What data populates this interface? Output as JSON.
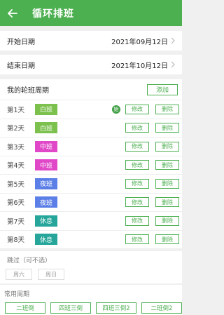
{
  "header": {
    "title": "循环排班"
  },
  "start": {
    "label": "开始日期",
    "value": "2021年09月12日"
  },
  "end": {
    "label": "结束日期",
    "value": "2021年10月12日"
  },
  "cycle": {
    "title": "我的轮班周期",
    "add_label": "添加",
    "start_badge": "始",
    "edit_label": "修改",
    "delete_label": "删除",
    "days": [
      {
        "day": "第1天",
        "shift": "白班",
        "color": "#7cc04e"
      },
      {
        "day": "第2天",
        "shift": "白班",
        "color": "#7cc04e"
      },
      {
        "day": "第3天",
        "shift": "中班",
        "color": "#e048c8"
      },
      {
        "day": "第4天",
        "shift": "中班",
        "color": "#e048c8"
      },
      {
        "day": "第5天",
        "shift": "夜班",
        "color": "#5b7fe6"
      },
      {
        "day": "第6天",
        "shift": "夜班",
        "color": "#5b7fe6"
      },
      {
        "day": "第7天",
        "shift": "休息",
        "color": "#26a69a"
      },
      {
        "day": "第8天",
        "shift": "休息",
        "color": "#26a69a"
      }
    ]
  },
  "skip": {
    "title": "跳过（可不选）",
    "options": [
      "周六",
      "周日"
    ]
  },
  "common": {
    "title": "常用周期",
    "items": [
      "二班倒",
      "四班三倒",
      "四班三倒2",
      "二班倒2"
    ]
  },
  "colors": {
    "accent": "#4caf50"
  }
}
